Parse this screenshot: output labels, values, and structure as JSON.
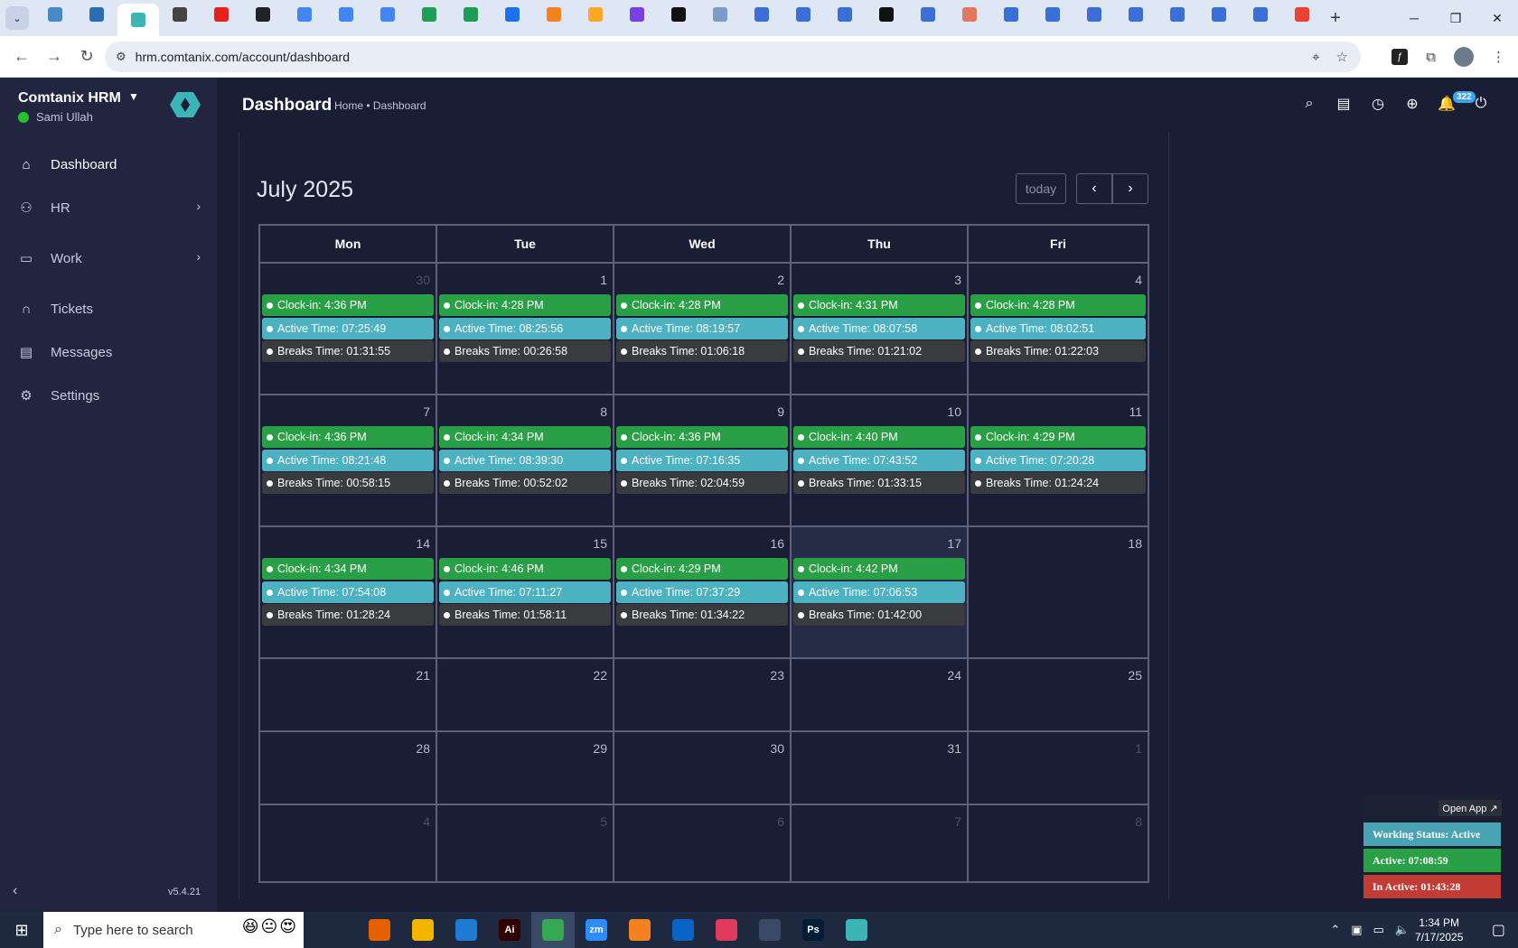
{
  "browser": {
    "url": "hrm.comtanix.com/account/dashboard",
    "tab_favicons": [
      {
        "icon": "chrome-tab-icon",
        "color": "#4a89c8"
      },
      {
        "icon": "vpn-tab-icon",
        "color": "#2a6db0"
      },
      {
        "icon": "comtanix-tab-icon",
        "color": "#3cb5b8",
        "active": true
      },
      {
        "icon": "chatgpt-tab-icon",
        "color": "#444444"
      },
      {
        "icon": "youtube-tab-icon",
        "color": "#e62117"
      },
      {
        "icon": "bolt-tab-icon",
        "color": "#222222"
      },
      {
        "icon": "docs-tab-icon",
        "color": "#4285f4"
      },
      {
        "icon": "docs-tab-icon",
        "color": "#4285f4"
      },
      {
        "icon": "docs-tab-icon",
        "color": "#4285f4"
      },
      {
        "icon": "sheets-tab-icon",
        "color": "#1e9d58"
      },
      {
        "icon": "sheets-tab-icon",
        "color": "#1e9d58"
      },
      {
        "icon": "marketing-tab-icon",
        "color": "#1a73e8"
      },
      {
        "icon": "xampp-tab-icon",
        "color": "#f58220"
      },
      {
        "icon": "vue-tab-icon",
        "color": "#f9a825"
      },
      {
        "icon": "brackets-tab-icon",
        "color": "#7b3fe4"
      },
      {
        "icon": "a-tab-icon",
        "color": "#111111"
      },
      {
        "icon": "repo-tab-icon",
        "color": "#7a9cc6"
      },
      {
        "icon": "forms-tab-icon",
        "color": "#3a6fd8"
      },
      {
        "icon": "forms-tab-icon",
        "color": "#3a6fd8"
      },
      {
        "icon": "forms-tab-icon",
        "color": "#3a6fd8"
      },
      {
        "icon": "m-tab-icon",
        "color": "#111111"
      },
      {
        "icon": "forms-tab-icon",
        "color": "#3a6fd8"
      },
      {
        "icon": "figma-tab-icon",
        "color": "#e07a5f"
      },
      {
        "icon": "forms-tab-icon",
        "color": "#3a6fd8"
      },
      {
        "icon": "forms-tab-icon",
        "color": "#3a6fd8"
      },
      {
        "icon": "forms-tab-icon",
        "color": "#3a6fd8"
      },
      {
        "icon": "forms-tab-icon",
        "color": "#3a6fd8"
      },
      {
        "icon": "forms-tab-icon",
        "color": "#3a6fd8"
      },
      {
        "icon": "forms-tab-icon",
        "color": "#3a6fd8"
      },
      {
        "icon": "forms-tab-icon",
        "color": "#3a6fd8"
      },
      {
        "icon": "google-tab-icon",
        "color": "#ea4335"
      }
    ]
  },
  "sidebar": {
    "brand": "Comtanix HRM",
    "user": "Sami Ullah",
    "items": [
      {
        "label": "Dashboard",
        "icon": "home-icon",
        "active": true,
        "arrow": false
      },
      {
        "label": "HR",
        "icon": "users-icon",
        "active": false,
        "arrow": true
      },
      {
        "label": "Work",
        "icon": "briefcase-icon",
        "active": false,
        "arrow": true
      },
      {
        "label": "Tickets",
        "icon": "headset-icon",
        "active": false,
        "arrow": false
      },
      {
        "label": "Messages",
        "icon": "message-icon",
        "active": false,
        "arrow": false
      },
      {
        "label": "Settings",
        "icon": "gear-icon",
        "active": false,
        "arrow": false
      }
    ],
    "version": "v5.4.21"
  },
  "topbar": {
    "title": "Dashboard",
    "breadcrumb": "Home • Dashboard",
    "notification_count": "322"
  },
  "calendar": {
    "month_title": "July 2025",
    "today_label": "today",
    "weekdays": [
      "Mon",
      "Tue",
      "Wed",
      "Thu",
      "Fri"
    ],
    "weeks": [
      [
        {
          "day": "30",
          "other": true,
          "clock_in": "Clock-in: 4:36 PM",
          "active": "Active Time: 07:25:49",
          "breaks": "Breaks Time: 01:31:55"
        },
        {
          "day": "1",
          "clock_in": "Clock-in: 4:28 PM",
          "active": "Active Time: 08:25:56",
          "breaks": "Breaks Time: 00:26:58"
        },
        {
          "day": "2",
          "clock_in": "Clock-in: 4:28 PM",
          "active": "Active Time: 08:19:57",
          "breaks": "Breaks Time: 01:06:18"
        },
        {
          "day": "3",
          "clock_in": "Clock-in: 4:31 PM",
          "active": "Active Time: 08:07:58",
          "breaks": "Breaks Time: 01:21:02"
        },
        {
          "day": "4",
          "clock_in": "Clock-in: 4:28 PM",
          "active": "Active Time: 08:02:51",
          "breaks": "Breaks Time: 01:22:03"
        }
      ],
      [
        {
          "day": "7",
          "clock_in": "Clock-in: 4:36 PM",
          "active": "Active Time: 08:21:48",
          "breaks": "Breaks Time: 00:58:15"
        },
        {
          "day": "8",
          "clock_in": "Clock-in: 4:34 PM",
          "active": "Active Time: 08:39:30",
          "breaks": "Breaks Time: 00:52:02"
        },
        {
          "day": "9",
          "clock_in": "Clock-in: 4:36 PM",
          "active": "Active Time: 07:16:35",
          "breaks": "Breaks Time: 02:04:59"
        },
        {
          "day": "10",
          "clock_in": "Clock-in: 4:40 PM",
          "active": "Active Time: 07:43:52",
          "breaks": "Breaks Time: 01:33:15"
        },
        {
          "day": "11",
          "clock_in": "Clock-in: 4:29 PM",
          "active": "Active Time: 07:20:28",
          "breaks": "Breaks Time: 01:24:24"
        }
      ],
      [
        {
          "day": "14",
          "clock_in": "Clock-in: 4:34 PM",
          "active": "Active Time: 07:54:08",
          "breaks": "Breaks Time: 01:28:24"
        },
        {
          "day": "15",
          "clock_in": "Clock-in: 4:46 PM",
          "active": "Active Time: 07:11:27",
          "breaks": "Breaks Time: 01:58:11"
        },
        {
          "day": "16",
          "clock_in": "Clock-in: 4:29 PM",
          "active": "Active Time: 07:37:29",
          "breaks": "Breaks Time: 01:34:22"
        },
        {
          "day": "17",
          "today": true,
          "clock_in": "Clock-in: 4:42 PM",
          "active": "Active Time: 07:06:53",
          "breaks": "Breaks Time: 01:42:00"
        },
        {
          "day": "18"
        }
      ],
      [
        {
          "day": "21"
        },
        {
          "day": "22"
        },
        {
          "day": "23"
        },
        {
          "day": "24"
        },
        {
          "day": "25"
        }
      ],
      [
        {
          "day": "28"
        },
        {
          "day": "29"
        },
        {
          "day": "30"
        },
        {
          "day": "31"
        },
        {
          "day": "1",
          "other": true
        }
      ],
      [
        {
          "day": "4",
          "other": true
        },
        {
          "day": "5",
          "other": true
        },
        {
          "day": "6",
          "other": true
        },
        {
          "day": "7",
          "other": true
        },
        {
          "day": "8",
          "other": true
        }
      ]
    ]
  },
  "widget": {
    "open_app": "Open App ↗",
    "working_status": "Working Status: Active",
    "active": "Active: 07:08:59",
    "inactive": "In Active: 01:43:28"
  },
  "taskbar": {
    "search_placeholder": "Type here to search",
    "apps": [
      {
        "icon": "task-view-icon",
        "label": "",
        "color": "#1f2a40"
      },
      {
        "icon": "firefox-icon",
        "label": "",
        "color": "#e66000"
      },
      {
        "icon": "file-explorer-icon",
        "label": "",
        "color": "#f4b400"
      },
      {
        "icon": "vscode-icon",
        "label": "",
        "color": "#1e7bd6"
      },
      {
        "icon": "illustrator-icon",
        "label": "Ai",
        "color": "#300000"
      },
      {
        "icon": "chrome-icon",
        "label": "",
        "color": "#34a853",
        "on": true
      },
      {
        "icon": "zoom-icon",
        "label": "zm",
        "color": "#2d8cff"
      },
      {
        "icon": "xampp-icon",
        "label": "",
        "color": "#f58220"
      },
      {
        "icon": "outlook-icon",
        "label": "",
        "color": "#0a64c8"
      },
      {
        "icon": "creative-cloud-icon",
        "label": "",
        "color": "#e03a5d"
      },
      {
        "icon": "pen-icon",
        "label": "",
        "color": "#3a4a66"
      },
      {
        "icon": "photoshop-icon",
        "label": "Ps",
        "color": "#001e36"
      },
      {
        "icon": "comtanix-app-icon",
        "label": "",
        "color": "#3cb5b8"
      }
    ],
    "time": "1:34 PM",
    "date": "7/17/2025"
  }
}
